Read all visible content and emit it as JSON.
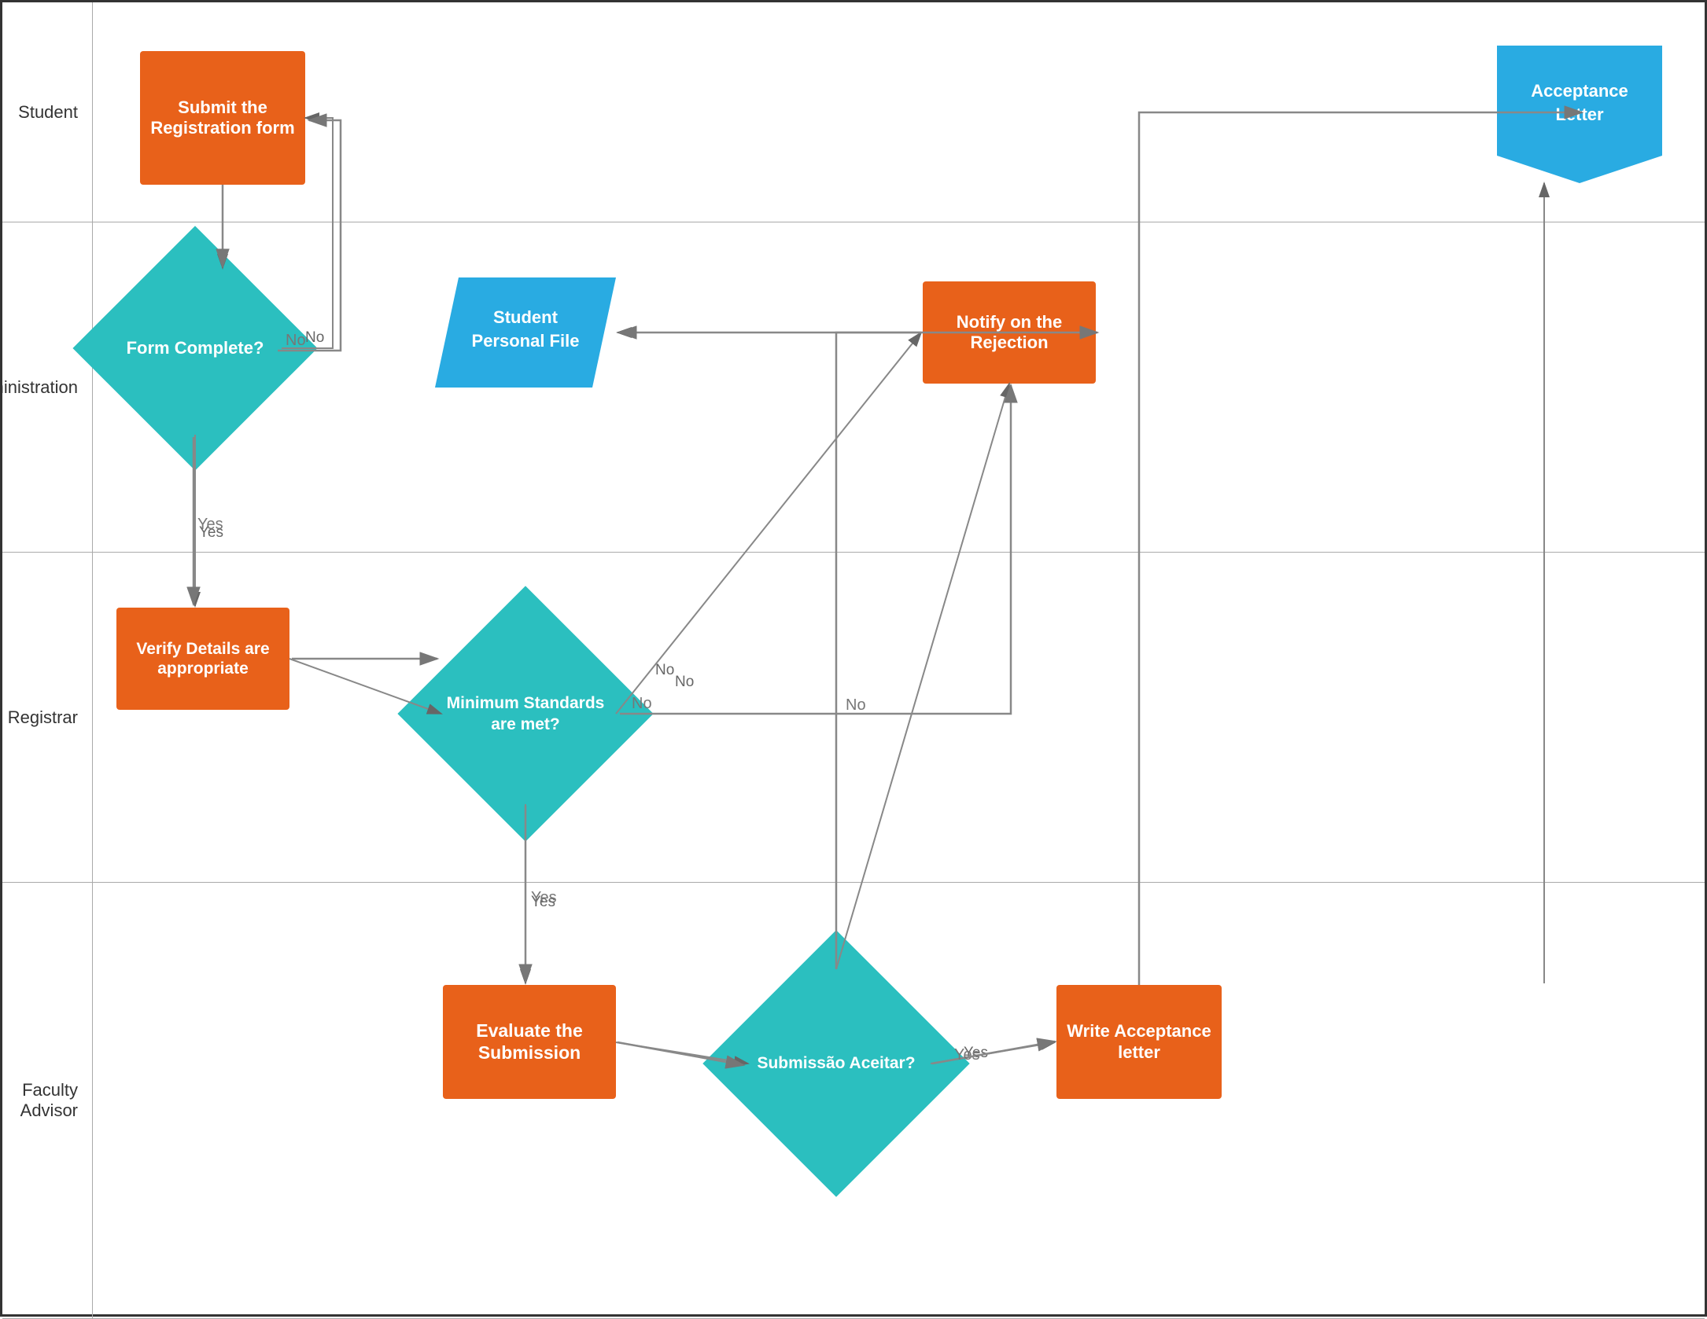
{
  "lanes": [
    {
      "id": "student",
      "label": "Student"
    },
    {
      "id": "admin",
      "label": "Administration"
    },
    {
      "id": "registrar",
      "label": "Registrar"
    },
    {
      "id": "faculty",
      "label": "Faculty Advisor"
    }
  ],
  "shapes": {
    "submit_form": "Submit the Registration form",
    "form_complete": "Form Complete?",
    "student_personal_file": "Student Personal File",
    "notify_rejection": "Notify on the Rejection",
    "acceptance_letter_doc": "Acceptance Letter",
    "verify_details": "Verify Details are appropriate",
    "min_standards": "Minimum Standards are met?",
    "evaluate_submission": "Evaluate the Submission",
    "submissao_aceitar": "Submissão Aceitar?",
    "write_acceptance": "Write Acceptance letter"
  },
  "labels": {
    "yes": "Yes",
    "no": "No"
  }
}
